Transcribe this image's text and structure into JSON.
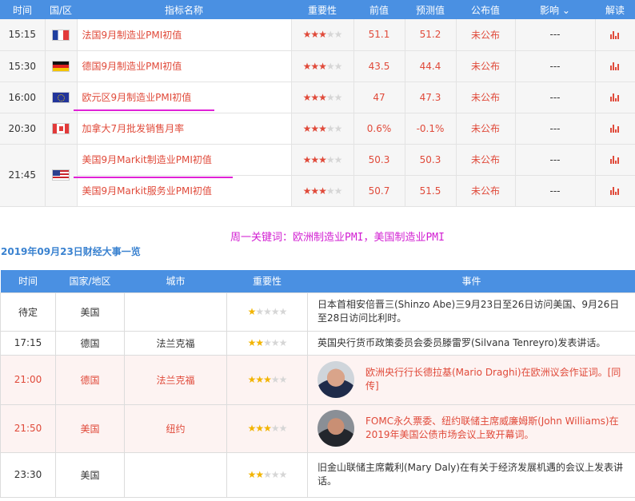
{
  "top_table": {
    "headers": {
      "time": "时间",
      "country": "国/区",
      "indicator": "指标名称",
      "importance": "重要性",
      "previous": "前值",
      "forecast": "预测值",
      "actual": "公布值",
      "impact": "影响",
      "analysis": "解读"
    },
    "rows": [
      {
        "time": "15:15",
        "flag": "france-flag",
        "indicator": "法国9月制造业PMI初值",
        "stars": 3,
        "previous": "51.1",
        "forecast": "51.2",
        "actual": "未公布",
        "impact": "---"
      },
      {
        "time": "15:30",
        "flag": "germany-flag",
        "indicator": "德国9月制造业PMI初值",
        "stars": 3,
        "previous": "43.5",
        "forecast": "44.4",
        "actual": "未公布",
        "impact": "---"
      },
      {
        "time": "16:00",
        "flag": "eu-flag",
        "indicator": "欧元区9月制造业PMI初值",
        "stars": 3,
        "previous": "47",
        "forecast": "47.3",
        "actual": "未公布",
        "impact": "---"
      },
      {
        "time": "20:30",
        "flag": "canada-flag",
        "indicator": "加拿大7月批发销售月率",
        "stars": 3,
        "previous": "0.6%",
        "forecast": "-0.1%",
        "actual": "未公布",
        "impact": "---"
      },
      {
        "time": "21:45",
        "flag": "us-flag",
        "indicator": "美国9月Markit制造业PMI初值",
        "stars": 3,
        "previous": "50.3",
        "forecast": "50.3",
        "actual": "未公布",
        "impact": "---"
      },
      {
        "time": "",
        "flag": "",
        "indicator": "美国9月Markit服务业PMI初值",
        "stars": 3,
        "previous": "50.7",
        "forecast": "51.5",
        "actual": "未公布",
        "impact": "---"
      }
    ]
  },
  "keywords": "周一关键词：欧洲制造业PMI，美国制造业PMI",
  "date_title": "2019年09月23日财经大事一览",
  "events_table": {
    "headers": {
      "time": "时间",
      "country": "国家/地区",
      "city": "城市",
      "importance": "重要性",
      "event": "事件"
    },
    "rows": [
      {
        "time": "待定",
        "country": "美国",
        "city": "",
        "stars": 1,
        "event": "日本首相安倍晋三(Shinzo Abe)三9月23日至26日访问美国、9月26日至28日访问比利时。",
        "highlight": false,
        "avatar": false
      },
      {
        "time": "17:15",
        "country": "德国",
        "city": "法兰克福",
        "stars": 2,
        "event": "英国央行货币政策委员会委员滕雷罗(Silvana Tenreyro)发表讲话。",
        "highlight": false,
        "avatar": false
      },
      {
        "time": "21:00",
        "country": "德国",
        "city": "法兰克福",
        "stars": 3,
        "event": "欧洲央行行长德拉基(Mario Draghi)在欧洲议会作证词。[同传]",
        "highlight": true,
        "avatar": true
      },
      {
        "time": "21:50",
        "country": "美国",
        "city": "纽约",
        "stars": 3,
        "event": "FOMC永久票委、纽约联储主席威廉姆斯(John Williams)在2019年美国公债市场会议上致开幕词。",
        "highlight": true,
        "avatar": true
      },
      {
        "time": "23:30",
        "country": "美国",
        "city": "",
        "stars": 2,
        "event": "旧金山联储主席戴利(Mary Daly)在有关于经济发展机遇的会议上发表讲话。",
        "highlight": false,
        "avatar": false
      }
    ]
  }
}
